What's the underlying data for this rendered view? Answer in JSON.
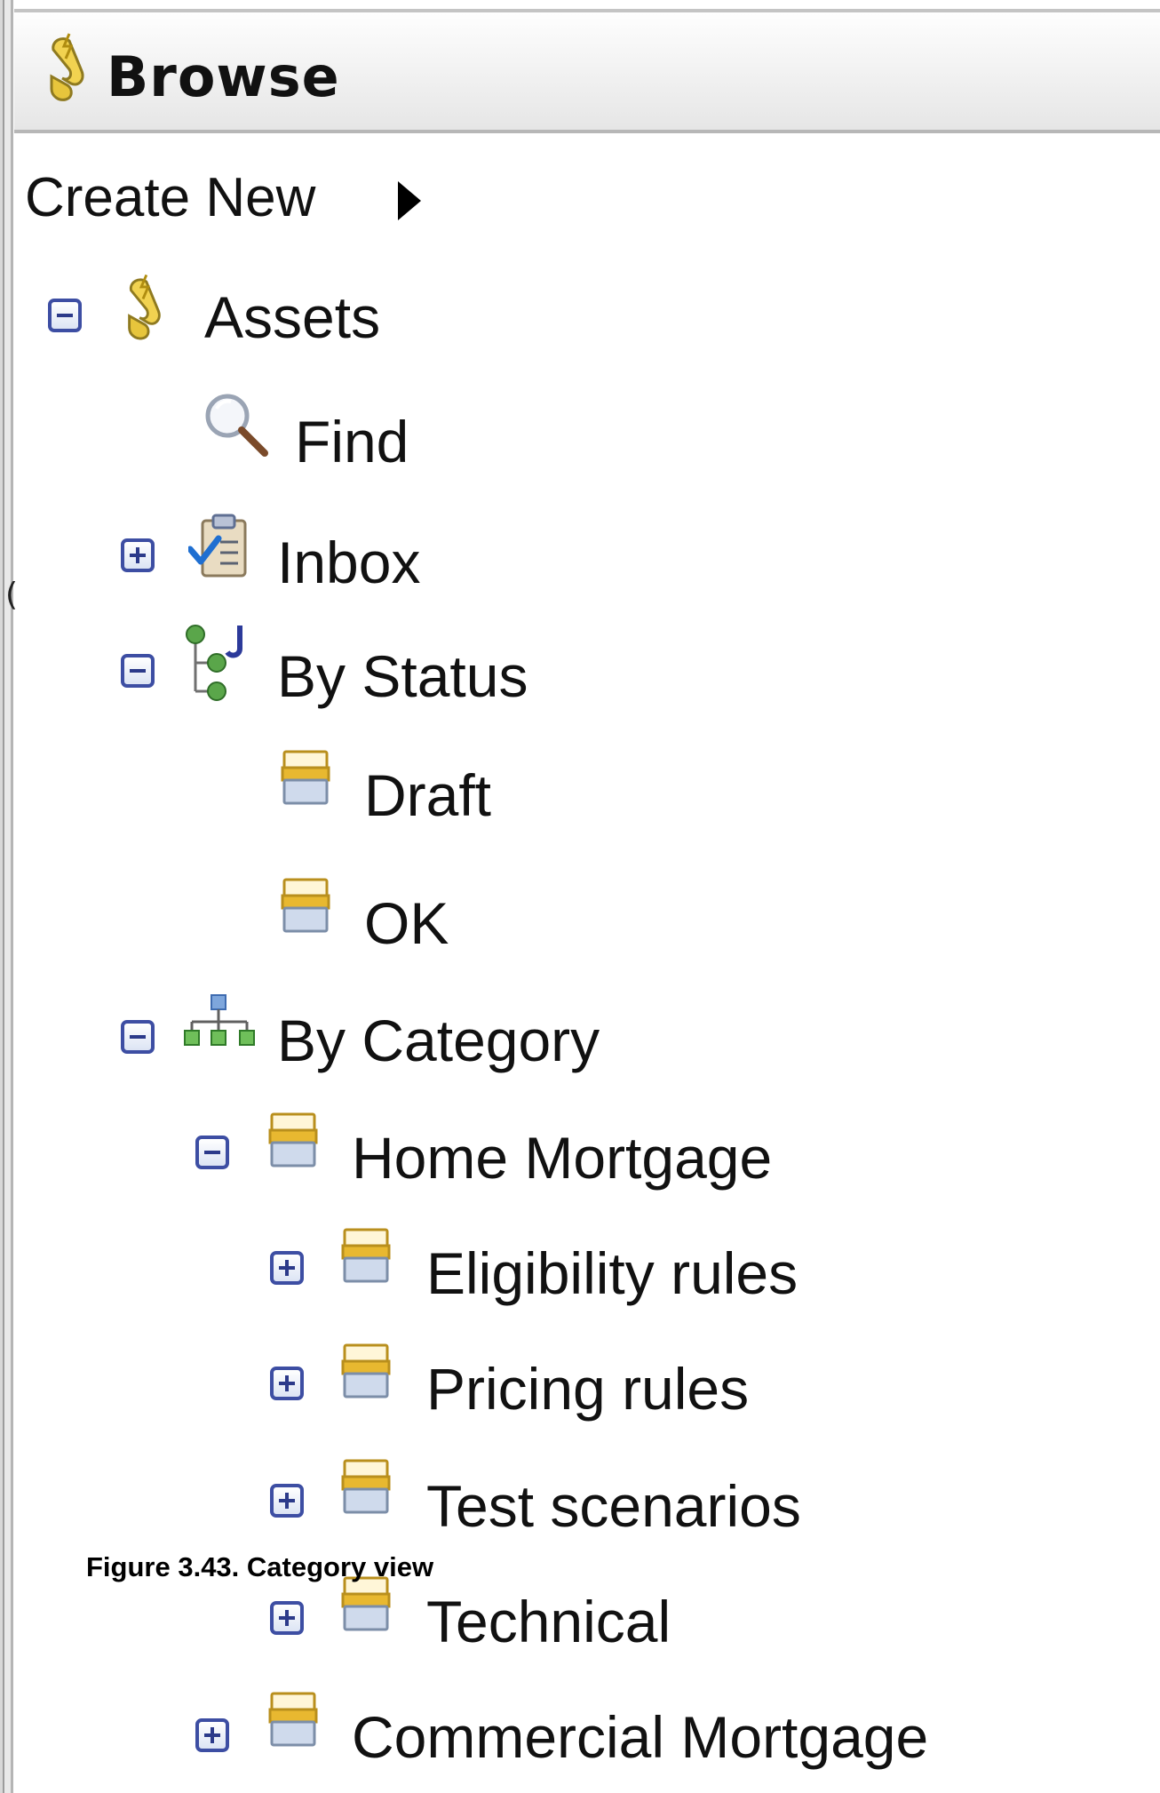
{
  "panel": {
    "title": "Browse",
    "title_icon": "lightning-scroll-icon",
    "create_new": {
      "label": "Create New",
      "arrow_icon": "submenu-arrow-icon"
    }
  },
  "tree": {
    "assets": {
      "label": "Assets",
      "icon": "lightning-scroll-icon",
      "state": "expanded"
    },
    "find": {
      "label": "Find",
      "icon": "magnifier-icon"
    },
    "inbox": {
      "label": "Inbox",
      "icon": "clipboard-check-icon",
      "state": "collapsed"
    },
    "by_status": {
      "label": "By Status",
      "icon": "status-tree-icon",
      "state": "expanded"
    },
    "draft": {
      "label": "Draft",
      "icon": "folder-tray-icon"
    },
    "ok": {
      "label": "OK",
      "icon": "folder-tray-icon"
    },
    "by_category": {
      "label": "By Category",
      "icon": "hierarchy-icon",
      "state": "expanded"
    },
    "home_mortgage": {
      "label": "Home Mortgage",
      "icon": "folder-tray-icon",
      "state": "expanded"
    },
    "eligibility_rules": {
      "label": "Eligibility rules",
      "icon": "folder-tray-icon",
      "state": "collapsed"
    },
    "pricing_rules": {
      "label": "Pricing rules",
      "icon": "folder-tray-icon",
      "state": "collapsed"
    },
    "test_scenarios": {
      "label": "Test scenarios",
      "icon": "folder-tray-icon",
      "state": "collapsed"
    },
    "technical": {
      "label": "Technical",
      "icon": "folder-tray-icon",
      "state": "collapsed"
    },
    "commercial_mortgage": {
      "label": "Commercial Mortgage",
      "icon": "folder-tray-icon",
      "state": "collapsed"
    }
  },
  "caption": "Figure 3.43. Category view",
  "colors": {
    "toggle_border": "#3d4ea3",
    "folder_gold": "#e8b830",
    "folder_blue": "#b9c8e0",
    "header_bg": "#eeeeee"
  }
}
